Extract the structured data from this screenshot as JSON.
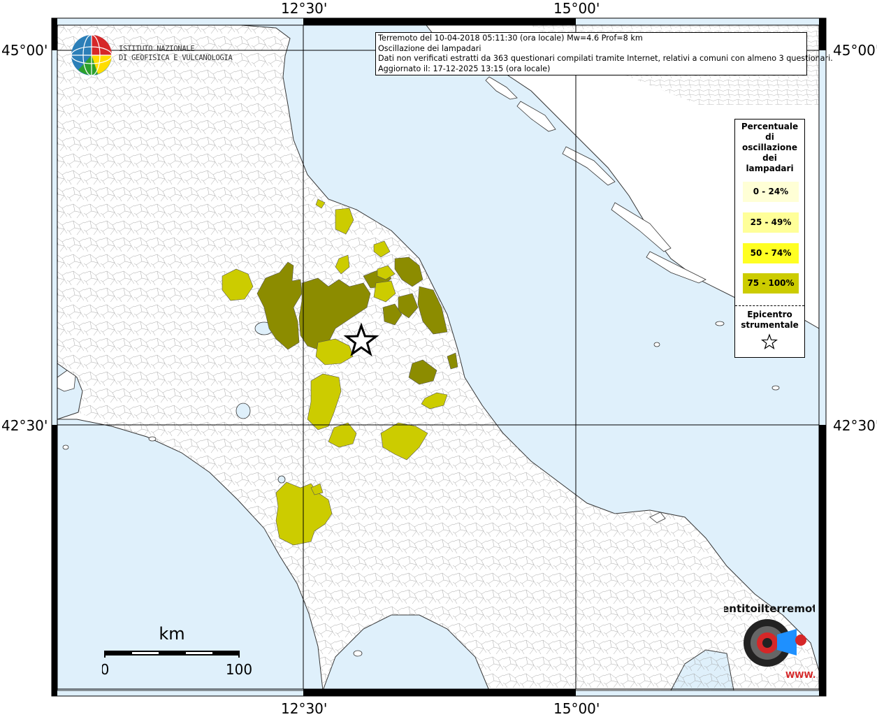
{
  "info": {
    "line1": "Terremoto del 10-04-2018 05:11:30 (ora locale) Mw=4.6 Prof=8 km",
    "line2": "Oscillazione dei lampadari",
    "line3": "Dati non verificati estratti da 363 questionari compilati tramite Internet, relativi a comuni con almeno 3 questionari.",
    "line4": "Aggiornato il: 17-12-2025 13:15 (ora locale)"
  },
  "axes": {
    "top_lon_1": "12°30'",
    "top_lon_2": "15°00'",
    "bottom_lon_1": "12°30'",
    "bottom_lon_2": "15°00'",
    "left_lat_1": "45°00'",
    "left_lat_2": "42°30'",
    "right_lat_1": "45°00'",
    "right_lat_2": "42°30'"
  },
  "logo": {
    "line1": "ISTITUTO NAZIONALE",
    "line2": "DI GEOFISICA E VULCANOLOGIA"
  },
  "legend": {
    "title": [
      "Percentuale",
      "di",
      "oscillazione",
      "dei",
      "lampadari"
    ],
    "classes": [
      {
        "label": "0 - 24%",
        "color": "#ffffd6"
      },
      {
        "label": "25 - 49%",
        "color": "#ffff99"
      },
      {
        "label": "50 - 74%",
        "color": "#ffff22"
      },
      {
        "label": "75 - 100%",
        "color": "#cccc00"
      }
    ],
    "epicenter_title": [
      "Epicentro",
      "strumentale"
    ]
  },
  "scale": {
    "unit": "km",
    "min": "0",
    "max": "100"
  },
  "colors": {
    "sea": "#dff0fb",
    "land": "#ffffff",
    "yellow_light": "#d8d800",
    "yellow_mid": "#cccc00",
    "olive": "#8c8c00"
  },
  "watermark": {
    "text": "haisentitoilterremoto.it",
    "sub": "WWW."
  }
}
